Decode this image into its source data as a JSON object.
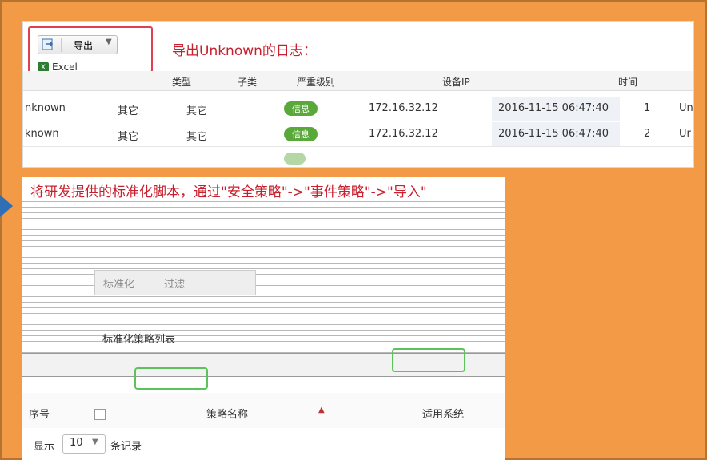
{
  "top_panel": {
    "export_button": "导出",
    "excel_item": "Excel",
    "caption": "导出Unknown的日志：",
    "headers": [
      "类型",
      "子类",
      "严重级别",
      "设备IP",
      "时间"
    ],
    "rows": [
      {
        "name": "nknown",
        "type": "其它",
        "subtype": "其它",
        "level": "信息",
        "ip": "172.16.32.12",
        "time": "2016-11-15 06:47:40",
        "num": "1",
        "tail": "Un"
      },
      {
        "name": "known",
        "type": "其它",
        "subtype": "其它",
        "level": "信息",
        "ip": "172.16.32.12",
        "time": "2016-11-15 06:47:40",
        "num": "2",
        "tail": "Ur"
      }
    ]
  },
  "bottom_panel": {
    "caption": "将研发提供的标准化脚本，通过\"安全策略\"->\"事件策略\"->\"导入\"",
    "tabs": [
      "标准化",
      "过滤"
    ],
    "list_title": "标准化策略列表",
    "table_headers": [
      "序号",
      "策略名称",
      "适用系统"
    ],
    "footer": {
      "show": "显示",
      "count": "10",
      "records": "条记录"
    }
  },
  "colors": {
    "background": "#f29a45",
    "caption": "#c8202e",
    "badge": "#5aa83a",
    "highlight_red": "#e04050",
    "highlight_green": "#5cc35a",
    "arrow": "#2f6fb5"
  }
}
